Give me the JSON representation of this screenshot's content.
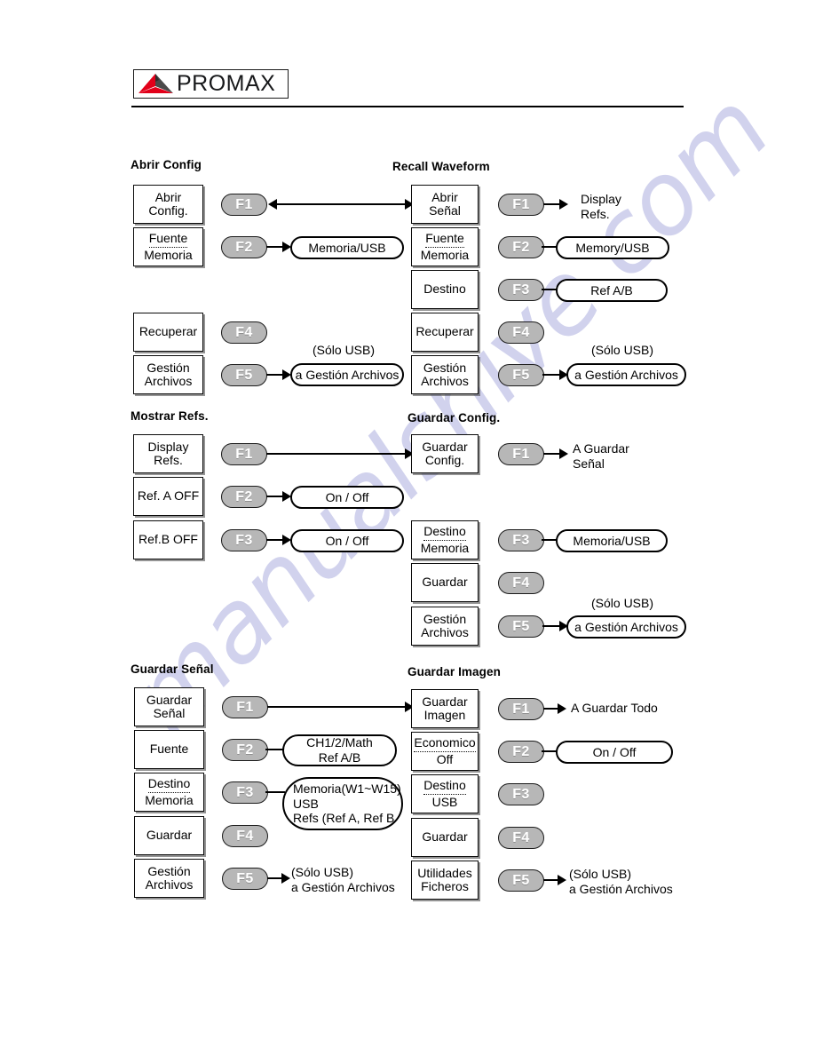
{
  "header": {
    "logo_text": "PROMAX",
    "logo_icon": "promax-triangle-logo",
    "logo_colors": {
      "red": "#e2001a",
      "dark": "#3a3a3a"
    }
  },
  "watermark": {
    "text": "manualshive.com"
  },
  "sections": [
    {
      "id": "abrir-config",
      "title": "Abrir Config",
      "rows": [
        {
          "key": "F1",
          "box": {
            "l1": "Abrir",
            "l2": "Config.",
            "dotted": false
          },
          "callout": null,
          "label": null
        },
        {
          "key": "F2",
          "box": {
            "l1": "Fuente",
            "l2": "Memoria",
            "dotted": true
          },
          "callout": "Memoria/USB",
          "label": null
        },
        {
          "key": "F4",
          "box": {
            "l1": "Recuperar",
            "l2": "",
            "dotted": false
          },
          "callout": null,
          "label": null
        },
        {
          "key": "F5",
          "box": {
            "l1": "Gestión",
            "l2": "Archivos",
            "dotted": false
          },
          "callout": "a Gestión Archivos",
          "note": "(Sólo USB)"
        }
      ]
    },
    {
      "id": "recall-waveform",
      "title": "Recall Waveform",
      "rows": [
        {
          "key": "F1",
          "box": {
            "l1": "Abrir",
            "l2": "Señal",
            "dotted": false
          },
          "callout": null,
          "label": "Display\nRefs."
        },
        {
          "key": "F2",
          "box": {
            "l1": "Fuente",
            "l2": "Memoria",
            "dotted": true
          },
          "callout": "Memory/USB",
          "label": null
        },
        {
          "key": "F3",
          "box": {
            "l1": "Destino",
            "l2": "",
            "dotted": false
          },
          "callout": "Ref A/B",
          "label": null
        },
        {
          "key": "F4",
          "box": {
            "l1": "Recuperar",
            "l2": "",
            "dotted": false
          },
          "callout": null,
          "label": null
        },
        {
          "key": "F5",
          "box": {
            "l1": "Gestión",
            "l2": "Archivos",
            "dotted": false
          },
          "callout": "a Gestión Archivos",
          "note": "(Sólo USB)"
        }
      ]
    },
    {
      "id": "mostrar-refs",
      "title": "Mostrar Refs.",
      "rows": [
        {
          "key": "F1",
          "box": {
            "l1": "Display",
            "l2": "Refs.",
            "dotted": false
          },
          "callout": null,
          "label": null
        },
        {
          "key": "F2",
          "box": {
            "l1": "Ref. A OFF",
            "l2": "",
            "dotted": false
          },
          "callout": "On / Off",
          "label": null
        },
        {
          "key": "F3",
          "box": {
            "l1": "Ref.B OFF",
            "l2": "",
            "dotted": false
          },
          "callout": "On / Off",
          "label": null
        }
      ]
    },
    {
      "id": "guardar-config",
      "title": "Guardar Config.",
      "rows": [
        {
          "key": "F1",
          "box": {
            "l1": "Guardar",
            "l2": "Config.",
            "dotted": false
          },
          "callout": null,
          "label": "A Guardar\nSeñal"
        },
        {
          "key": "F3",
          "box": {
            "l1": "Destino",
            "l2": "Memoria",
            "dotted": true
          },
          "callout": "Memoria/USB",
          "label": null
        },
        {
          "key": "F4",
          "box": {
            "l1": "Guardar",
            "l2": "",
            "dotted": false
          },
          "callout": null,
          "label": null
        },
        {
          "key": "F5",
          "box": {
            "l1": "Gestión",
            "l2": "Archivos",
            "dotted": false
          },
          "callout": "a Gestión Archivos",
          "note": "(Sólo USB)"
        }
      ]
    },
    {
      "id": "guardar-senal",
      "title": "Guardar Señal",
      "rows": [
        {
          "key": "F1",
          "box": {
            "l1": "Guardar",
            "l2": "Señal",
            "dotted": false
          },
          "callout": null,
          "label": null
        },
        {
          "key": "F2",
          "box": {
            "l1": "Fuente",
            "l2": "",
            "dotted": false
          },
          "callout": "CH1/2/Math\nRef A/B",
          "label": null
        },
        {
          "key": "F3",
          "box": {
            "l1": "Destino",
            "l2": "Memoria",
            "dotted": true
          },
          "callout": "Memoria(W1~W15)\nUSB\nRefs (Ref A, Ref B",
          "label": null
        },
        {
          "key": "F4",
          "box": {
            "l1": "Guardar",
            "l2": "",
            "dotted": false
          },
          "callout": null,
          "label": null
        },
        {
          "key": "F5",
          "box": {
            "l1": "Gestión",
            "l2": "Archivos",
            "dotted": false
          },
          "callout": null,
          "label": "(Sólo USB)\na Gestión Archivos"
        }
      ]
    },
    {
      "id": "guardar-imagen",
      "title": "Guardar Imagen",
      "rows": [
        {
          "key": "F1",
          "box": {
            "l1": "Guardar",
            "l2": "Imagen",
            "dotted": false
          },
          "callout": null,
          "label": "A Guardar Todo"
        },
        {
          "key": "F2",
          "box": {
            "l1": "Economico",
            "l2": "Off",
            "dotted": true
          },
          "callout": "On / Off",
          "label": null
        },
        {
          "key": "F3",
          "box": {
            "l1": "Destino",
            "l2": "USB",
            "dotted": true
          },
          "callout": null,
          "label": null
        },
        {
          "key": "F4",
          "box": {
            "l1": "Guardar",
            "l2": "",
            "dotted": false
          },
          "callout": null,
          "label": null
        },
        {
          "key": "F5",
          "box": {
            "l1": "Utilidades",
            "l2": "Ficheros",
            "dotted": false
          },
          "callout": null,
          "label": "(Sólo USB)\na Gestión Archivos"
        }
      ]
    }
  ],
  "notes": {
    "solo_usb": "(Sólo USB)"
  },
  "keys": {
    "f1": "F1",
    "f2": "F2",
    "f3": "F3",
    "f4": "F4",
    "f5": "F5"
  }
}
